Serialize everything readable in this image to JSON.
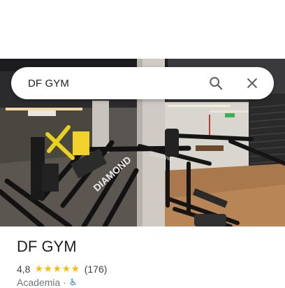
{
  "search": {
    "query": "DF GYM"
  },
  "icons": {
    "search": "search-icon",
    "close": "close-icon",
    "accessibility": "wheelchair-accessible-icon"
  },
  "photo": {
    "sign_text": "DIAMOND",
    "brand_text": "Diamond"
  },
  "place": {
    "name": "DF GYM",
    "rating": "4,8",
    "stars": "★★★★★",
    "reviews": "(176)",
    "category": "Academia",
    "separator": "·"
  },
  "colors": {
    "star": "#fbbc04",
    "accent": "#1a73e8",
    "text": "#202124"
  }
}
